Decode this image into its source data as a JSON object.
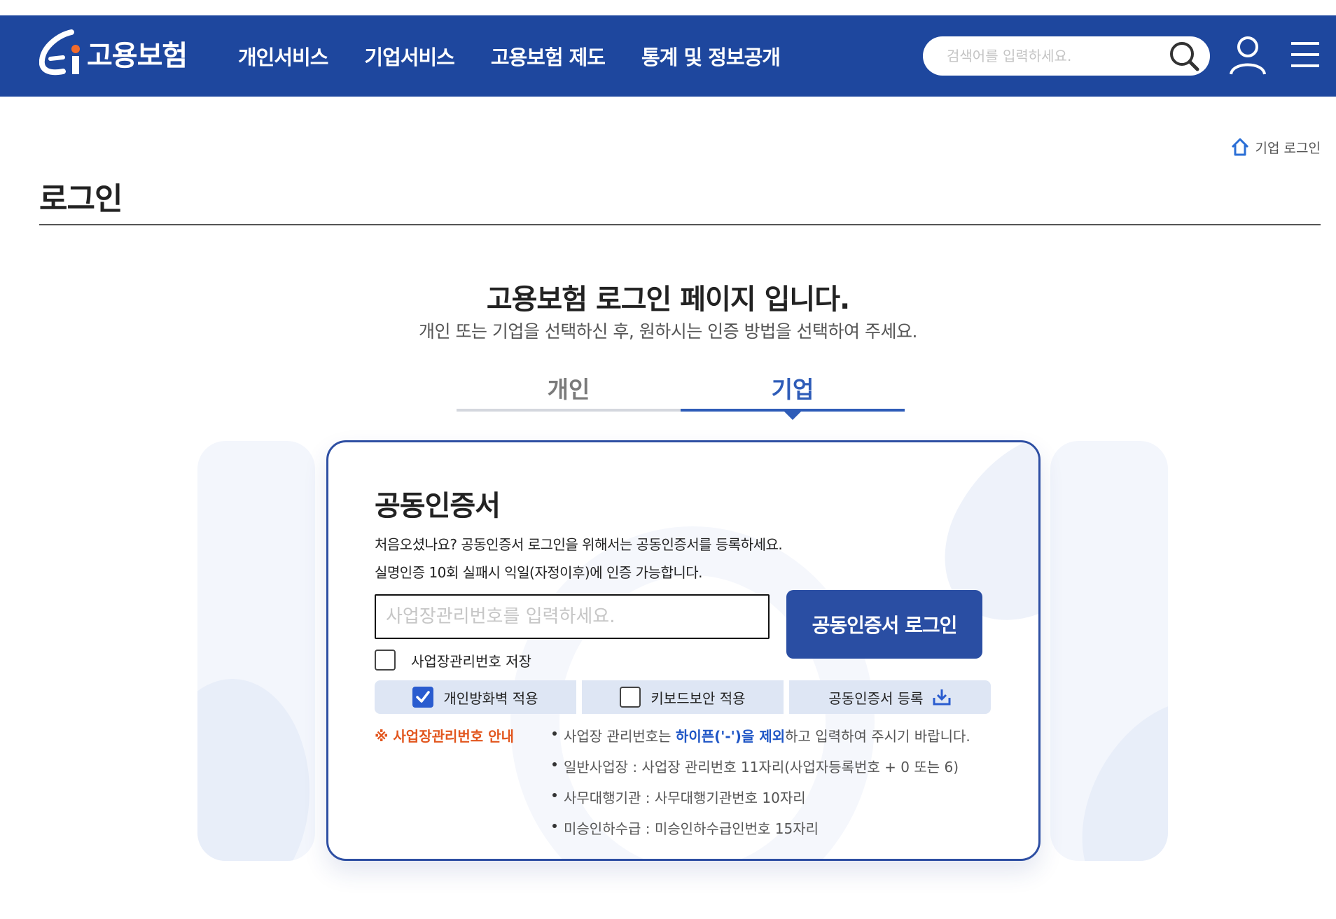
{
  "header": {
    "logo_text": "고용보험",
    "nav": [
      "개인서비스",
      "기업서비스",
      "고용보험 제도",
      "통계 및 정보공개"
    ],
    "search_placeholder": "검색어를 입력하세요."
  },
  "breadcrumb": {
    "current": "기업 로그인"
  },
  "page_title": "로그인",
  "intro": {
    "heading": "고용보험 로그인 페이지 입니다.",
    "sub": "개인 또는 기업을 선택하신 후, 원하시는 인증 방법을 선택하여 주세요."
  },
  "tabs": [
    {
      "label": "개인",
      "active": false
    },
    {
      "label": "기업",
      "active": true
    }
  ],
  "card": {
    "title": "공동인증서",
    "desc1": "처음오셨나요? 공동인증서 로그인을 위해서는 공동인증서를 등록하세요.",
    "desc2": "실명인증 10회 실패시 익일(자정이후)에 인증 가능합니다.",
    "input_placeholder": "사업장관리번호를 입력하세요.",
    "login_button": "공동인증서 로그인",
    "save_label": "사업장관리번호 저장",
    "options": {
      "firewall": "개인방화벽 적용",
      "keyboard": "키보드보안 적용",
      "register": "공동인증서 등록"
    },
    "notice_title": "※ 사업장관리번호 안내",
    "notice": {
      "line1_pre": "사업장 관리번호는 ",
      "line1_hl": "하이픈('-')을 제외",
      "line1_post": "하고 입력하여 주시기 바랍니다.",
      "line2": "일반사업장 : 사업장 관리번호 11자리(사업자등록번호 + 0 또는 6)",
      "line3": "사무대행기관 : 사무대행기관번호 10자리",
      "line4": "미승인하수급 : 미승인하수급인번호 15자리"
    }
  },
  "colors": {
    "header_bg": "#1e479e",
    "accent": "#2e5cb8",
    "button": "#2a4ea3",
    "notice": "#e2561e"
  }
}
